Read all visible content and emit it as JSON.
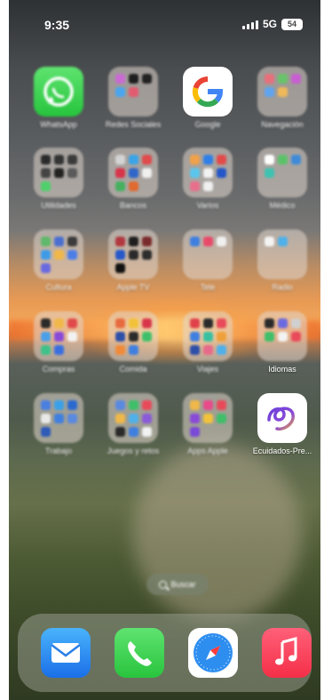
{
  "status_bar": {
    "time": "9:35",
    "network": "5G",
    "battery": "54"
  },
  "home": {
    "apps": [
      {
        "label": "WhatsApp",
        "type": "app",
        "icon": "whatsapp-icon"
      },
      {
        "label": "Redes Sociales",
        "type": "folder"
      },
      {
        "label": "Google",
        "type": "app",
        "icon": "google-icon"
      },
      {
        "label": "Navegación",
        "type": "folder"
      },
      {
        "label": "Utilidades",
        "type": "folder"
      },
      {
        "label": "Bancos",
        "type": "folder"
      },
      {
        "label": "Varios",
        "type": "folder"
      },
      {
        "label": "Médico",
        "type": "folder"
      },
      {
        "label": "Cultura",
        "type": "folder"
      },
      {
        "label": "Apple TV",
        "type": "folder"
      },
      {
        "label": "Tele",
        "type": "folder"
      },
      {
        "label": "Radio",
        "type": "folder"
      },
      {
        "label": "Compras",
        "type": "folder"
      },
      {
        "label": "Comida",
        "type": "folder"
      },
      {
        "label": "Viajes",
        "type": "folder"
      },
      {
        "label": "Idiomas",
        "type": "folder"
      },
      {
        "label": "Trabajo",
        "type": "folder"
      },
      {
        "label": "Juegos y retos",
        "type": "folder"
      },
      {
        "label": "Apps Apple",
        "type": "folder"
      },
      {
        "label": "Ecuidados-Pre...",
        "type": "app",
        "icon": "ecuidados-icon"
      }
    ]
  },
  "search": {
    "label": "Buscar"
  },
  "dock": [
    "Mail",
    "Teléfono",
    "Safari",
    "Música"
  ],
  "colors": {
    "whatsapp": "#25D366",
    "mail": "#1b6fe8",
    "phone": "#29c43e",
    "music": "#f52f48"
  }
}
